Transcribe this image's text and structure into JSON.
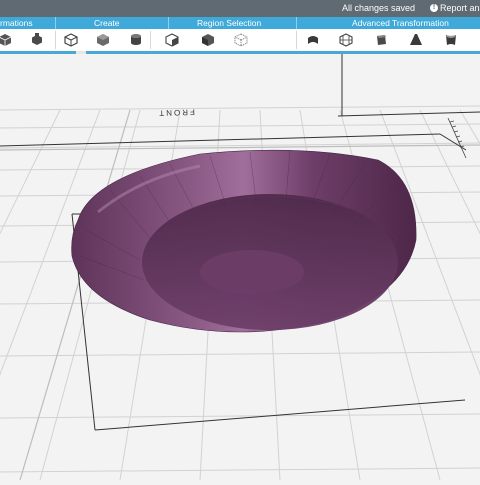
{
  "topbar": {
    "status_text": "All changes saved",
    "report_label": "Report an iss"
  },
  "groups": [
    {
      "label": "rmations"
    },
    {
      "label": "Create"
    },
    {
      "label": "Region Selection"
    },
    {
      "label": "Advanced Transformation"
    }
  ],
  "tools": [
    {
      "name": "transform-cube-tool",
      "icon": "cube-icon"
    },
    {
      "name": "scale-tool",
      "icon": "scale-cube-icon"
    },
    {
      "name": "create-box-tool",
      "icon": "box-outline-icon"
    },
    {
      "name": "create-solid-tool",
      "icon": "solid-cube-icon"
    },
    {
      "name": "create-cylinder-tool",
      "icon": "cylinder-icon"
    },
    {
      "name": "select-region-tool",
      "icon": "region-cube-icon"
    },
    {
      "name": "select-solid-tool",
      "icon": "select-solid-icon"
    },
    {
      "name": "select-wire-tool",
      "icon": "wire-cube-icon"
    },
    {
      "name": "bend-tool",
      "icon": "bend-icon"
    },
    {
      "name": "lattice-tool",
      "icon": "lattice-cube-icon"
    },
    {
      "name": "twist-tool",
      "icon": "twist-icon"
    },
    {
      "name": "taper-tool",
      "icon": "taper-icon"
    },
    {
      "name": "warp-tool",
      "icon": "warp-icon"
    }
  ],
  "viewport": {
    "front_label": "FRONT",
    "model_color": "#6b3c66",
    "grid_color": "#cfcfcf"
  }
}
